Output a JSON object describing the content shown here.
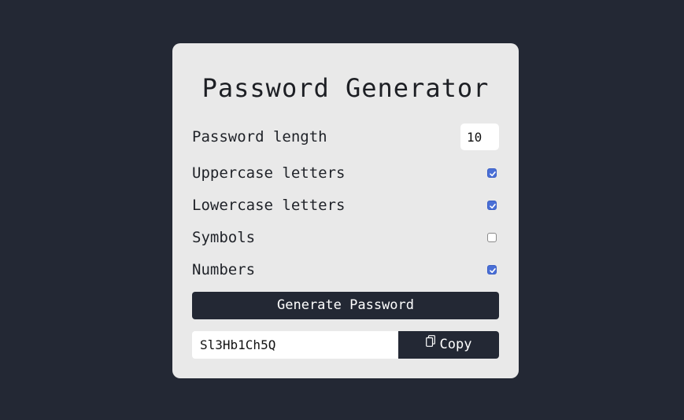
{
  "app": {
    "title": "Password Generator"
  },
  "length": {
    "label": "Password length",
    "value": "10"
  },
  "options": [
    {
      "label": "Uppercase letters",
      "checked": true
    },
    {
      "label": "Lowercase letters",
      "checked": true
    },
    {
      "label": "Symbols",
      "checked": false
    },
    {
      "label": "Numbers",
      "checked": true
    }
  ],
  "generate": {
    "label": "Generate Password"
  },
  "output": {
    "password": "Sl3Hb1Ch5Q",
    "copy_label": "Copy",
    "copy_icon": "clipboard-icon"
  },
  "colors": {
    "background": "#232834",
    "card": "#e9e9e9",
    "button": "#232834",
    "checkbox_accent": "#4a6fd6"
  }
}
